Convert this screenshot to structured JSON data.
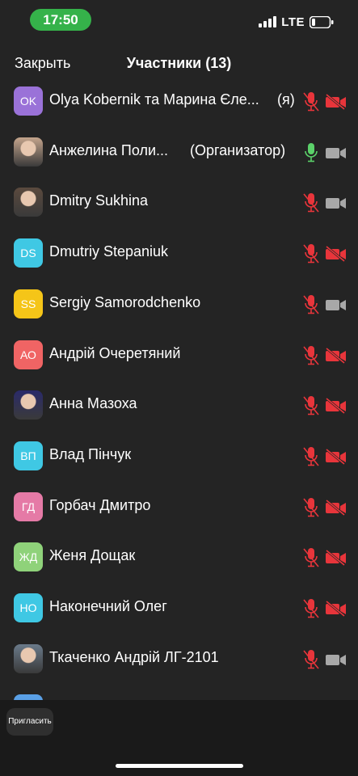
{
  "status": {
    "time": "17:50",
    "network": "LTE"
  },
  "nav": {
    "close_label": "Закрыть",
    "title": "Участники (13)"
  },
  "participants": [
    {
      "initials": "OK",
      "name": "Olya Kobernik та Марина Єле...",
      "suffix": "(я)",
      "avatar_color": "#9a72d8",
      "avatar_type": "initials",
      "mic": "muted",
      "cam": "off"
    },
    {
      "initials": "",
      "name": "Анжелина Поли...",
      "suffix": "(Организатор)",
      "avatar_color": "#c4a48c",
      "avatar_type": "photo",
      "mic": "on",
      "cam": "on"
    },
    {
      "initials": "",
      "name": "Dmitry Sukhina",
      "suffix": "",
      "avatar_color": "#5b4a3e",
      "avatar_type": "photo",
      "mic": "muted",
      "cam": "on"
    },
    {
      "initials": "DS",
      "name": "Dmutriy Stepaniuk",
      "suffix": "",
      "avatar_color": "#3fc8e4",
      "avatar_type": "initials",
      "mic": "muted",
      "cam": "off"
    },
    {
      "initials": "SS",
      "name": "Sergiy Samorodchenko",
      "suffix": "",
      "avatar_color": "#f5c518",
      "avatar_type": "initials",
      "mic": "muted",
      "cam": "on"
    },
    {
      "initials": "АО",
      "name": "Андрій Очеретяний",
      "suffix": "",
      "avatar_color": "#f06464",
      "avatar_type": "initials",
      "mic": "muted",
      "cam": "off"
    },
    {
      "initials": "",
      "name": "Анна Мазоха",
      "suffix": "",
      "avatar_color": "#2a2a6a",
      "avatar_type": "photo",
      "mic": "muted",
      "cam": "off"
    },
    {
      "initials": "ВП",
      "name": "Влад Пінчук",
      "suffix": "",
      "avatar_color": "#3fc8e4",
      "avatar_type": "initials",
      "mic": "muted",
      "cam": "off"
    },
    {
      "initials": "ГД",
      "name": "Горбач Дмитро",
      "suffix": "",
      "avatar_color": "#e57aa6",
      "avatar_type": "initials",
      "mic": "muted",
      "cam": "off"
    },
    {
      "initials": "ЖД",
      "name": "Женя Дощак",
      "suffix": "",
      "avatar_color": "#8fd27a",
      "avatar_type": "initials",
      "mic": "muted",
      "cam": "off"
    },
    {
      "initials": "НО",
      "name": "Наконечний Олег",
      "suffix": "",
      "avatar_color": "#3fc8e4",
      "avatar_type": "initials",
      "mic": "muted",
      "cam": "off"
    },
    {
      "initials": "",
      "name": "Ткаченко Андрій ЛГ-2101",
      "suffix": "",
      "avatar_color": "#6a7a8a",
      "avatar_type": "photo",
      "mic": "muted",
      "cam": "on"
    },
    {
      "initials": "",
      "name": "",
      "suffix": "",
      "avatar_color": "#5aa0e6",
      "avatar_type": "initials",
      "mic": "muted",
      "cam": "off"
    }
  ],
  "bottom": {
    "invite_label": "Пригласить"
  },
  "colors": {
    "muted": "#e8353b",
    "active_mic": "#5bd16a",
    "camera_on": "#a8a8a8"
  }
}
